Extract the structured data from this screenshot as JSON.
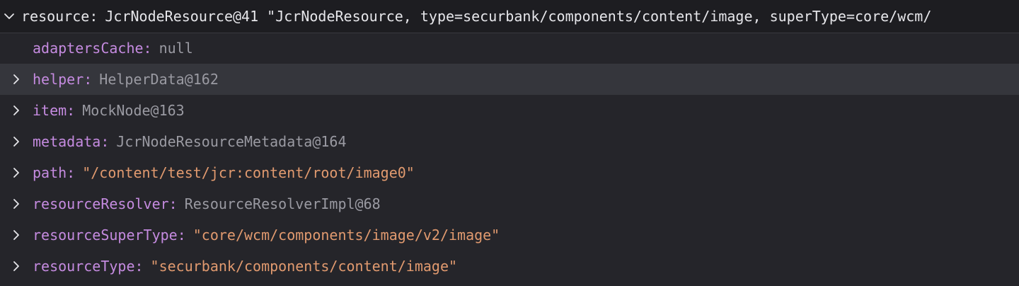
{
  "tree": {
    "root": {
      "key": "resource",
      "value": "JcrNodeResource@41 \"JcrNodeResource, type=securbank/components/content/image, superType=core/wcm/",
      "expanded": true
    },
    "children": [
      {
        "key": "adaptersCache",
        "value": "null",
        "value_kind": "plain",
        "expandable": false
      },
      {
        "key": "helper",
        "value": "HelperData@162",
        "value_kind": "plain",
        "expandable": true
      },
      {
        "key": "item",
        "value": "MockNode@163",
        "value_kind": "plain",
        "expandable": true
      },
      {
        "key": "metadata",
        "value": "JcrNodeResourceMetadata@164",
        "value_kind": "plain",
        "expandable": true
      },
      {
        "key": "path",
        "value": "\"/content/test/jcr:content/root/image0\"",
        "value_kind": "string",
        "expandable": true
      },
      {
        "key": "resourceResolver",
        "value": "ResourceResolverImpl@68",
        "value_kind": "plain",
        "expandable": true
      },
      {
        "key": "resourceSuperType",
        "value": "\"core/wcm/components/image/v2/image\"",
        "value_kind": "string",
        "expandable": true
      },
      {
        "key": "resourceType",
        "value": "\"securbank/components/content/image\"",
        "value_kind": "string",
        "expandable": true
      }
    ],
    "colon": ":"
  },
  "icons": {
    "expanded": "chevron-down-icon",
    "collapsed": "chevron-right-icon"
  },
  "colors": {
    "background": "#25252a",
    "root_background": "#1d1d21",
    "hover_row": "#35363c",
    "key": "#c58be0",
    "value": "#9a9aa2",
    "string": "#e19a6f"
  }
}
